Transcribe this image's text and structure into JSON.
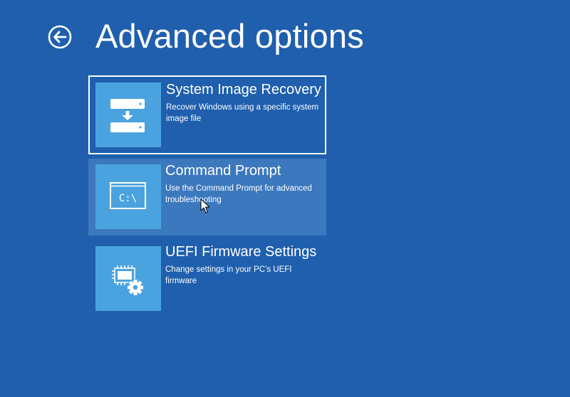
{
  "page": {
    "title": "Advanced options",
    "back_icon": "back-arrow-circle-icon"
  },
  "colors": {
    "background": "#1f5fad",
    "tile": "#4aa3df",
    "hover_background": "#3c78bd",
    "text": "#ffffff"
  },
  "options": [
    {
      "title": "System Image Recovery",
      "description": "Recover Windows using a specific system image file",
      "icon": "disk-restore-icon",
      "state": "selected"
    },
    {
      "title": "Command Prompt",
      "description": "Use the Command Prompt for advanced troubleshooting",
      "icon": "command-prompt-icon",
      "icon_text": "C:\\",
      "state": "hovered"
    },
    {
      "title": "UEFI Firmware Settings",
      "description": "Change settings in your PC’s UEFI firmware",
      "icon": "chip-gear-icon",
      "state": "normal"
    }
  ]
}
